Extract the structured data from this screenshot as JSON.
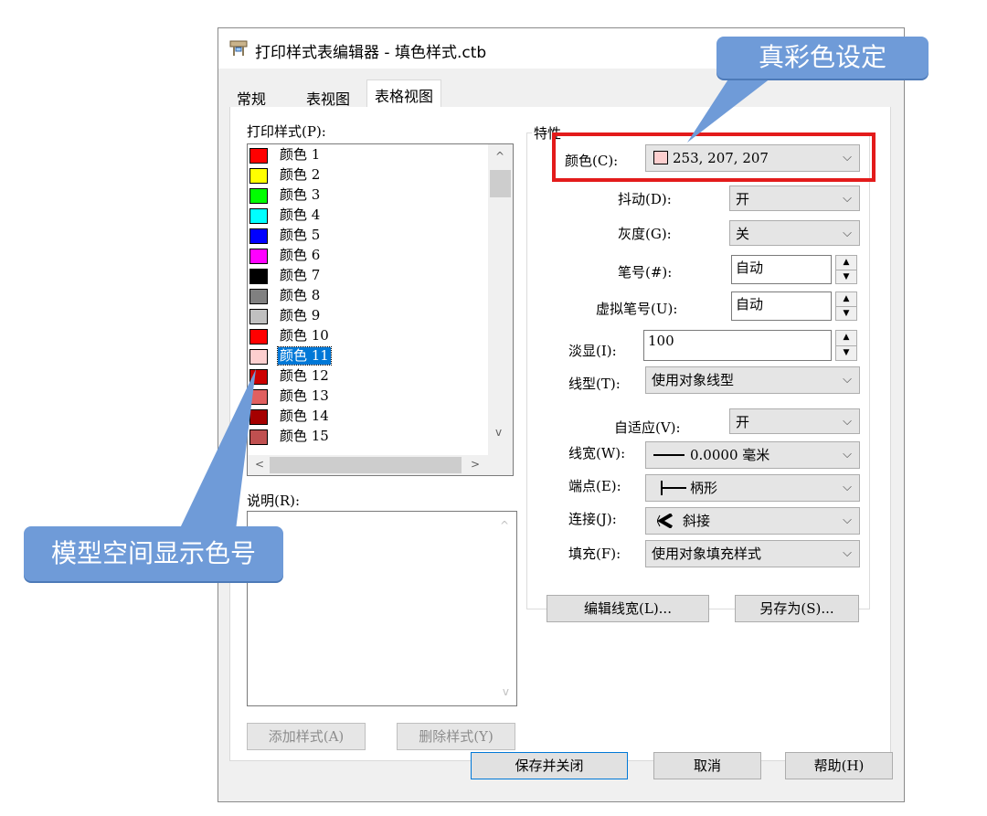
{
  "window": {
    "title": "打印样式表编辑器 - 填色样式.ctb",
    "app_icon": "plotter-icon"
  },
  "tabs": [
    {
      "label": "常规",
      "active": false
    },
    {
      "label": "表视图",
      "active": false
    },
    {
      "label": "表格视图",
      "active": true
    }
  ],
  "styles_panel": {
    "label": "打印样式(P):",
    "items": [
      {
        "label": "颜色 1",
        "color": "#ff0000"
      },
      {
        "label": "颜色 2",
        "color": "#ffff00"
      },
      {
        "label": "颜色 3",
        "color": "#00ff00"
      },
      {
        "label": "颜色 4",
        "color": "#00ffff"
      },
      {
        "label": "颜色 5",
        "color": "#0000ff"
      },
      {
        "label": "颜色 6",
        "color": "#ff00ff"
      },
      {
        "label": "颜色 7",
        "color": "#000000"
      },
      {
        "label": "颜色 8",
        "color": "#808080"
      },
      {
        "label": "颜色 9",
        "color": "#c0c0c0"
      },
      {
        "label": "颜色 10",
        "color": "#ff0000"
      },
      {
        "label": "颜色 11",
        "color": "#fdcfcf",
        "selected": true
      },
      {
        "label": "颜色 12",
        "color": "#cc0000"
      },
      {
        "label": "颜色 13",
        "color": "#e06060"
      },
      {
        "label": "颜色 14",
        "color": "#a50000"
      },
      {
        "label": "颜色 15",
        "color": "#c05050"
      }
    ]
  },
  "description": {
    "label": "说明(R):",
    "value": ""
  },
  "buttons": {
    "add_style": "添加样式(A)",
    "delete_style": "删除样式(Y)",
    "edit_lineweights": "编辑线宽(L)...",
    "save_as": "另存为(S)...",
    "save_close": "保存并关闭",
    "cancel": "取消",
    "help": "帮助(H)"
  },
  "properties": {
    "group_label": "特性",
    "color": {
      "label": "颜色(C):",
      "value": "253, 207, 207",
      "swatch": "#fdcfcf"
    },
    "dither": {
      "label": "抖动(D):",
      "value": "开"
    },
    "grayscale": {
      "label": "灰度(G):",
      "value": "关"
    },
    "pen": {
      "label": "笔号(#):",
      "value": "自动"
    },
    "virtual_pen": {
      "label": "虚拟笔号(U):",
      "value": "自动"
    },
    "screening": {
      "label": "淡显(I):",
      "value": "100"
    },
    "linetype": {
      "label": "线型(T):",
      "value": "使用对象线型"
    },
    "adaptive": {
      "label": "自适应(V):",
      "value": "开"
    },
    "lineweight": {
      "label": "线宽(W):",
      "value": "0.0000 毫米"
    },
    "line_end": {
      "label": "端点(E):",
      "value": "柄形"
    },
    "line_join": {
      "label": "连接(J):",
      "value": "斜接"
    },
    "fill": {
      "label": "填充(F):",
      "value": "使用对象填充样式"
    }
  },
  "annotations": {
    "true_color": "真彩色设定",
    "model_space": "模型空间显示色号",
    "callout_color": "#6f9bd8",
    "highlight_color": "#e31b1b"
  }
}
